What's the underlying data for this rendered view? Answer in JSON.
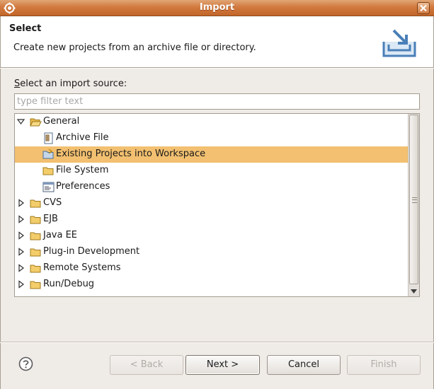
{
  "window": {
    "title": "Import"
  },
  "banner": {
    "heading": "Select",
    "description": "Create new projects from an archive file or directory.",
    "icon": "import-wizard-icon"
  },
  "source": {
    "label_accesskey": "S",
    "label_rest": "elect an import source:",
    "filter_placeholder": "type filter text",
    "filter_value": ""
  },
  "tree": {
    "items": [
      {
        "label": "General",
        "expanded": true,
        "icon": "folder-open-icon"
      },
      {
        "label": "Archive File",
        "icon": "archive-file-icon"
      },
      {
        "label": "Existing Projects into Workspace",
        "icon": "existing-projects-icon",
        "selected": true
      },
      {
        "label": "File System",
        "icon": "folder-icon"
      },
      {
        "label": "Preferences",
        "icon": "preferences-icon"
      },
      {
        "label": "CVS",
        "expanded": false,
        "icon": "folder-icon"
      },
      {
        "label": "EJB",
        "expanded": false,
        "icon": "folder-icon"
      },
      {
        "label": "Java EE",
        "expanded": false,
        "icon": "folder-icon"
      },
      {
        "label": "Plug-in Development",
        "expanded": false,
        "icon": "folder-icon"
      },
      {
        "label": "Remote Systems",
        "expanded": false,
        "icon": "folder-icon"
      },
      {
        "label": "Run/Debug",
        "expanded": false,
        "icon": "folder-icon"
      }
    ]
  },
  "buttons": {
    "back": "< Back",
    "next": "Next >",
    "cancel": "Cancel",
    "finish": "Finish"
  },
  "colors": {
    "titlebar": "#d27a3f",
    "selection": "#f2c070",
    "folder": "#e8b84d"
  }
}
